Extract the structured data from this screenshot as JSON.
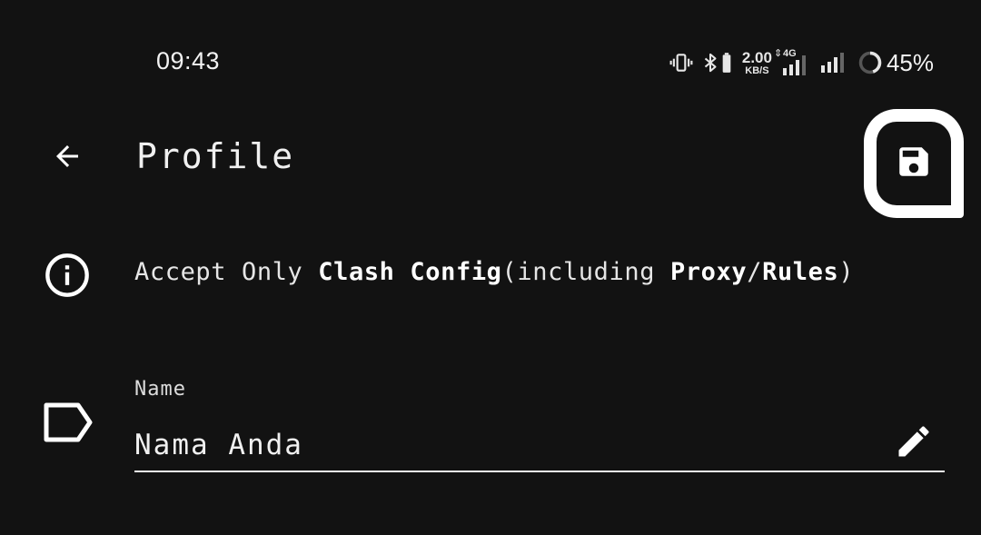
{
  "status_bar": {
    "time": "09:43",
    "net_speed_value": "2.00",
    "net_speed_unit": "KB/S",
    "network_type": "4G",
    "battery_percent": "45%",
    "icons": [
      "vibrate-icon",
      "bluetooth-icon",
      "battery-saver-icon",
      "data-arrows-icon",
      "signal-icon",
      "signal-icon",
      "battery-ring-icon"
    ]
  },
  "app_bar": {
    "title": "Profile",
    "back_icon": "arrow-left-icon",
    "save_icon": "floppy-disk-icon"
  },
  "info": {
    "icon": "info-icon",
    "parts": [
      {
        "text": "Accept Only ",
        "bold": false
      },
      {
        "text": "Clash Config",
        "bold": true
      },
      {
        "text": "(including ",
        "bold": false
      },
      {
        "text": "Proxy",
        "bold": true
      },
      {
        "text": "/",
        "bold": false
      },
      {
        "text": "Rules",
        "bold": true
      },
      {
        "text": ")",
        "bold": false
      }
    ]
  },
  "name_field": {
    "icon": "label-tag-icon",
    "label": "Name",
    "value": "Nama Anda",
    "edit_icon": "pencil-icon"
  },
  "colors": {
    "background": "#121212",
    "foreground": "#ffffff"
  }
}
